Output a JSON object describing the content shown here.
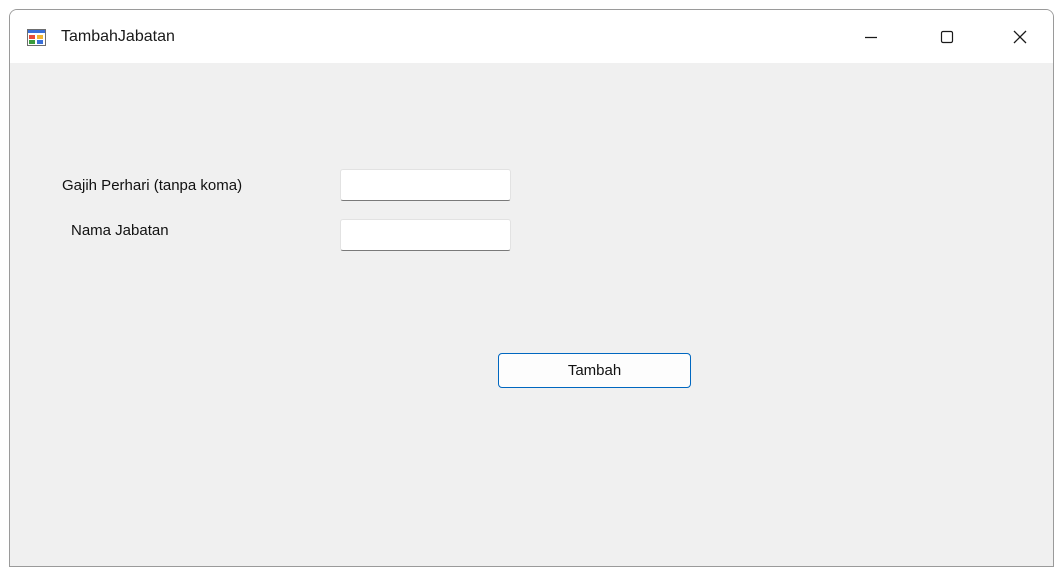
{
  "window": {
    "title": "TambahJabatan",
    "app_icon": "winforms-app-icon",
    "controls": {
      "minimize_icon": "minimize-icon",
      "maximize_icon": "maximize-icon",
      "close_icon": "close-icon"
    }
  },
  "form": {
    "fields": [
      {
        "label": "Gajih Perhari (tanpa koma)",
        "value": "",
        "placeholder": ""
      },
      {
        "label": "Nama Jabatan",
        "value": "",
        "placeholder": ""
      }
    ],
    "submit_label": "Tambah"
  },
  "colors": {
    "window_bg": "#f0f0f0",
    "titlebar_bg": "#ffffff",
    "button_accent": "#0067c0"
  }
}
